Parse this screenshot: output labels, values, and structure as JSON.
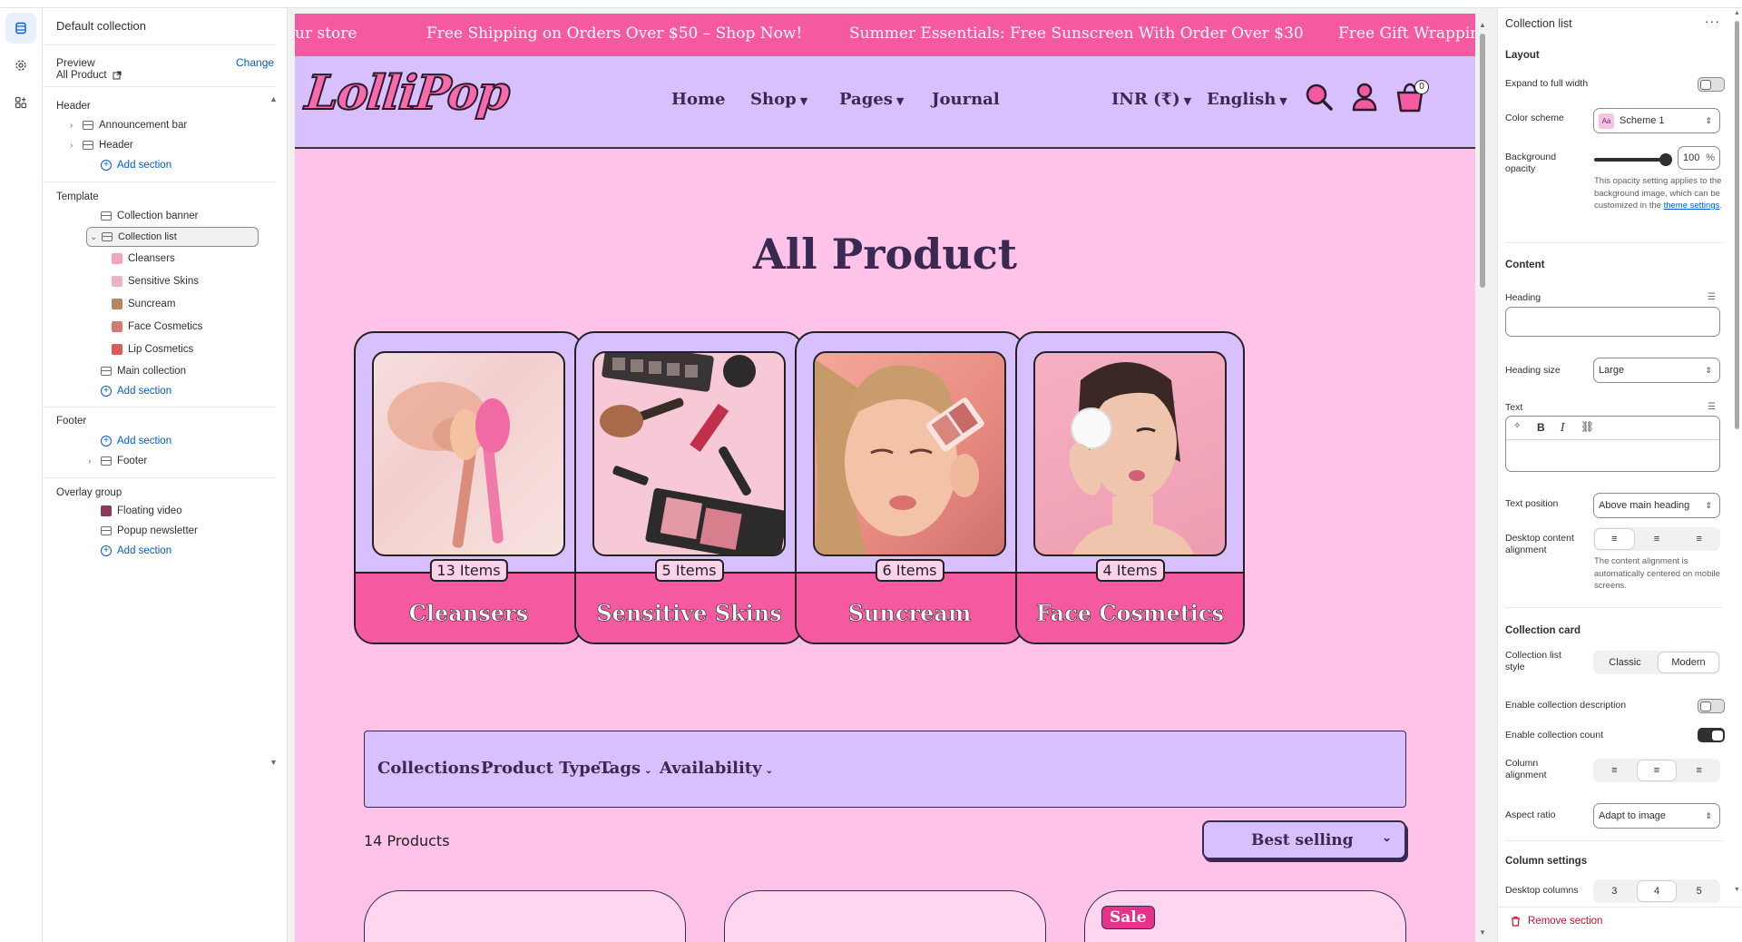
{
  "left_panel": {
    "collection": "Default collection",
    "preview_label": "Preview",
    "change_label": "Change",
    "preview_value": "All Product",
    "header_group": "Header",
    "header_items": [
      "Announcement bar",
      "Header"
    ],
    "add_section": "Add section",
    "template_group": "Template",
    "template_items": {
      "collection_banner": "Collection banner",
      "collection_list": "Collection list",
      "blocks": [
        "Cleansers",
        "Sensitive Skins",
        "Suncream",
        "Face Cosmetics",
        "Lip Cosmetics"
      ],
      "main_collection": "Main collection"
    },
    "footer_group": "Footer",
    "footer_item": "Footer",
    "overlay_group": "Overlay group",
    "overlay_items": [
      "Floating video",
      "Popup newsletter"
    ]
  },
  "site": {
    "announcements": [
      "ur store",
      "Free Shipping on Orders Over $50 – Shop Now!",
      "Summer Essentials: Free Sunscreen With Order Over $30",
      "Free Gift Wrapping"
    ],
    "logo": "LolliPop",
    "nav": [
      "Home",
      "Shop",
      "Pages",
      "Journal"
    ],
    "currency": "INR (₹)",
    "language": "English",
    "cart_count": "0",
    "page_title": "All Product",
    "collections": [
      {
        "name": "Cleansers",
        "count": "13 Items"
      },
      {
        "name": "Sensitive Skins",
        "count": "5 Items"
      },
      {
        "name": "Suncream",
        "count": "6 Items"
      },
      {
        "name": "Face Cosmetics",
        "count": "4 Items"
      }
    ],
    "filters": [
      "Collections",
      "Product Type",
      "Tags",
      "Availability"
    ],
    "product_count": "14 Products",
    "sort": "Best selling",
    "sale_badge": "Sale",
    "colors": {
      "announcement": "#f55aa0",
      "header": "#d7c0fd",
      "page": "#ffc2e8",
      "text": "#3a2950"
    }
  },
  "right_panel": {
    "title": "Collection list",
    "layout": "Layout",
    "expand_full_width": "Expand to full width",
    "color_scheme_label": "Color scheme",
    "color_scheme_value": "Scheme 1",
    "bg_opacity_label": "Background opacity",
    "bg_opacity_value": "100",
    "bg_opacity_unit": "%",
    "bg_opacity_level": 1.0,
    "opacity_help": "This opacity setting applies to the background image, which can be customized in the",
    "theme_settings_link": "theme settings",
    "content": "Content",
    "heading_label": "Heading",
    "heading_size_label": "Heading size",
    "heading_size_value": "Large",
    "text_label": "Text",
    "text_position_label": "Text position",
    "text_position_value": "Above main heading",
    "desktop_alignment_label": "Desktop content alignment",
    "alignment_help": "The content alignment is automatically centered on mobile screens.",
    "collection_card": "Collection card",
    "list_style_label": "Collection list style",
    "list_style_options": [
      "Classic",
      "Modern"
    ],
    "enable_description": "Enable collection description",
    "enable_count": "Enable collection count",
    "column_alignment_label": "Column alignment",
    "aspect_ratio_label": "Aspect ratio",
    "aspect_ratio_value": "Adapt to image",
    "column_settings": "Column settings",
    "desktop_columns_label": "Desktop columns",
    "desktop_columns_options": [
      "3",
      "4",
      "5"
    ],
    "remove_section": "Remove section"
  }
}
